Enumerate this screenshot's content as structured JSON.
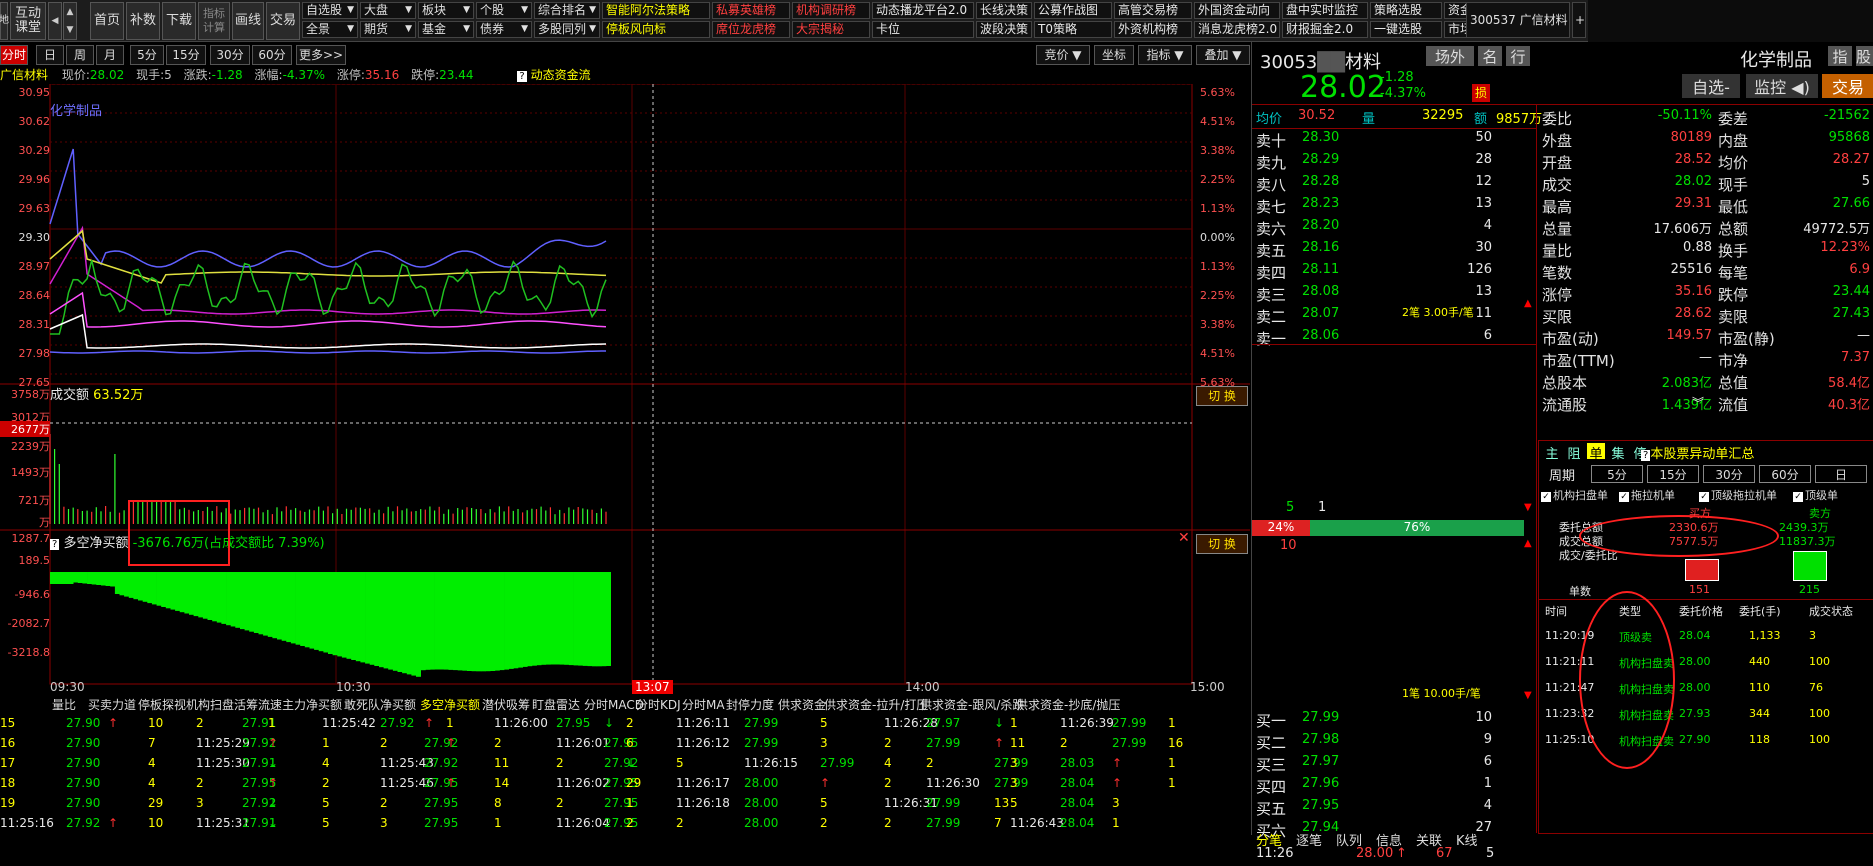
{
  "toolbar": {
    "left_btns": [
      "互动\n课堂",
      "首页",
      "补数",
      "下载",
      "指标\n计算",
      "画线",
      "交易"
    ],
    "menu_row1": [
      {
        "t": "自选股",
        "a": true
      },
      {
        "t": "大盘",
        "a": true
      },
      {
        "t": "板块",
        "a": true
      },
      {
        "t": "个股",
        "a": true
      },
      {
        "t": "综合排名",
        "a": true
      },
      {
        "t": "智能阿尔法策略",
        "c": "yl"
      },
      {
        "t": "私募英雄榜",
        "c": "rd"
      },
      {
        "t": "机构调研榜",
        "c": "rd"
      },
      {
        "t": "动态播龙平台2.0",
        "c": "wh"
      },
      {
        "t": "长线决策",
        "c": "wh"
      },
      {
        "t": "公募作战图",
        "c": "wh"
      },
      {
        "t": "高管交易榜",
        "c": "wh"
      },
      {
        "t": "外国资金动向",
        "c": "wh"
      },
      {
        "t": "盘中实时监控",
        "c": "wh"
      },
      {
        "t": "策略选股",
        "c": "wh"
      },
      {
        "t": "资金动向",
        "c": "wh"
      }
    ],
    "menu_row2": [
      {
        "t": "全景",
        "a": true
      },
      {
        "t": "期货",
        "a": true
      },
      {
        "t": "基金",
        "a": true
      },
      {
        "t": "债券",
        "a": true
      },
      {
        "t": "多股同列",
        "a": true
      },
      {
        "t": "停板风向标",
        "c": "yl"
      },
      {
        "t": "席位龙虎榜",
        "c": "rd"
      },
      {
        "t": "大宗揭秘",
        "c": "rd"
      },
      {
        "t": "卡位",
        "c": "wh"
      },
      {
        "t": "波段决策",
        "c": "wh"
      },
      {
        "t": "T0策略",
        "c": "wh"
      },
      {
        "t": "外资机构榜",
        "c": "wh"
      },
      {
        "t": "消息龙虎榜2.0",
        "c": "wh"
      },
      {
        "t": "财报掘金2.0",
        "c": "wh"
      },
      {
        "t": "一键选股",
        "c": "wh"
      },
      {
        "t": "市场全景图",
        "c": "wh"
      }
    ],
    "stock_tab": "300537 广信材料",
    "plus": "+"
  },
  "periods": [
    "分时",
    "日",
    "周",
    "月",
    "5分",
    "15分",
    "30分",
    "60分",
    "更多>>"
  ],
  "period_right": [
    "竞价",
    "坐标",
    "指标",
    "叠加"
  ],
  "header": {
    "name": "广信材料",
    "price_label": "现价:",
    "price": "28.02",
    "vol_label": "现手:",
    "vol": "5",
    "chg_label": "涨跌:",
    "chg": "-1.28",
    "pct_label": "涨幅:",
    "pct": "-4.37%",
    "up_label": "涨停:",
    "up": "35.16",
    "dn_label": "跌停:",
    "dn": "23.44",
    "flow": "动态资金流"
  },
  "chart": {
    "sector": "化学制品",
    "left_ticks": [
      "30.95",
      "30.62",
      "30.29",
      "29.96",
      "29.63",
      "29.30",
      "28.97",
      "28.64",
      "28.31",
      "27.98",
      "27.65"
    ],
    "right_ticks": [
      "5.63%",
      "4.51%",
      "3.38%",
      "2.25%",
      "1.13%",
      "0.00%",
      "1.13%",
      "2.25%",
      "3.38%",
      "4.51%",
      "5.63%"
    ],
    "vol_title": "成交额",
    "vol_value": "63.52万",
    "vol_ticks": [
      "3758万",
      "3012万",
      "2677万",
      "2239万",
      "1493万",
      "721万",
      "万"
    ],
    "ind_title": "多空净买额",
    "ind_value": "-3676.76万(占成交额比 7.39%)",
    "ind_ticks": [
      "1287.7",
      "189.5",
      "-946.6",
      "-2082.7",
      "-3218.8"
    ],
    "switch": "切 换",
    "time_ticks": [
      "09:30",
      "10:30",
      "13:07",
      "14:00",
      "15:00"
    ]
  },
  "tabs": [
    "量比",
    "买卖力道",
    "停板探视",
    "机构扫盘",
    "活筹流速",
    "主力净买额",
    "敢死队净买额",
    "多空净买额",
    "潜伏吸筹",
    "盯盘雷达",
    "分时MACD",
    "分时KDJ",
    "分时MA",
    "封停力度",
    "供求资金",
    "供求资金-拉升/打压",
    "供求资金-跟风/杀跌",
    "供求资金-抄底/抛压"
  ],
  "ticks": [
    [
      "15",
      "27.90",
      "↑",
      "10",
      "2",
      "27.91",
      "1",
      "11:25:42",
      "27.92",
      "↑",
      "1",
      "11:26:00",
      "27.95",
      "↓",
      "2",
      "11:26:11",
      "27.99",
      "5",
      "11:26:28",
      "27.97",
      "↓",
      "1",
      "11:26:39",
      "27.99",
      "1"
    ],
    [
      "16",
      "27.90",
      "",
      "7",
      "11:25:29",
      "27.92",
      "↑",
      "1",
      "2",
      "27.92",
      "↑",
      "2",
      "11:26:01",
      "27.95",
      "6",
      "11:26:12",
      "27.99",
      "3",
      "2",
      "27.99",
      "↑",
      "11",
      "2",
      "27.99",
      "16"
    ],
    [
      "17",
      "27.90",
      "",
      "4",
      "11:25:30",
      "27.91",
      "↓",
      "4",
      "11:25:43",
      "27.92",
      "",
      "11",
      "2",
      "27.92",
      "↓",
      "5",
      "11:26:15",
      "27.99",
      "4",
      "2",
      "27.99",
      "3",
      "28.03",
      "↑",
      "1"
    ],
    [
      "18",
      "27.90",
      "",
      "4",
      "2",
      "27.95",
      "↑",
      "2",
      "11:25:46",
      "27.95",
      "↑",
      "14",
      "11:26:02",
      "27.95",
      "29",
      "11:26:17",
      "28.00",
      "↑",
      "2",
      "11:26:30",
      "27.99",
      "3",
      "28.04",
      "↑",
      "1"
    ],
    [
      "19",
      "27.90",
      "",
      "29",
      "3",
      "27.92",
      "↓",
      "5",
      "2",
      "27.95",
      "",
      "8",
      "2",
      "27.95",
      "1",
      "11:26:18",
      "28.00",
      "5",
      "11:26:31",
      "27.99",
      "13",
      "5",
      "28.04",
      "3"
    ],
    [
      "11:25:16",
      "27.92",
      "↑",
      "10",
      "11:25:31",
      "27.91",
      "↓",
      "5",
      "3",
      "27.95",
      "",
      "1",
      "11:26:04",
      "27.95",
      "2",
      "2",
      "28.00",
      "2",
      "2",
      "27.99",
      "7",
      "11:26:43",
      "28.04",
      "1"
    ]
  ],
  "rp": {
    "code": "30053",
    "name_tail": "材料",
    "mkt": "场外",
    "btn_ming": "名",
    "btn_hang": "行",
    "sector": "化学制品",
    "zhi": "指",
    "gu": "股",
    "price": "28.02",
    "chg": "-1.28",
    "pct": "-4.37%",
    "badge": "损",
    "xuan": "自选",
    "jk": "监控",
    "jy": "交易",
    "avg_l": "均价",
    "avg": "30.52",
    "vol_l": "量",
    "vol": "32295",
    "amt_l": "额",
    "amt": "9857万",
    "sells": [
      [
        "卖十",
        "28.30",
        "50"
      ],
      [
        "卖九",
        "28.29",
        "28"
      ],
      [
        "卖八",
        "28.28",
        "12"
      ],
      [
        "卖七",
        "28.23",
        "13"
      ],
      [
        "卖六",
        "28.20",
        "4"
      ],
      [
        "卖五",
        "28.16",
        "30"
      ],
      [
        "卖四",
        "28.11",
        "126"
      ],
      [
        "卖三",
        "28.08",
        "13"
      ],
      [
        "卖二",
        "28.07",
        "11"
      ],
      [
        "卖一",
        "28.06",
        "6"
      ]
    ],
    "buys": [
      [
        "买一",
        "27.99",
        "10"
      ],
      [
        "买二",
        "27.98",
        "9"
      ],
      [
        "买三",
        "27.97",
        "6"
      ],
      [
        "买四",
        "27.96",
        "1"
      ],
      [
        "买五",
        "27.95",
        "4"
      ],
      [
        "买六",
        "27.94",
        "27"
      ]
    ],
    "stats": [
      [
        "委比",
        "-50.11%",
        "委差",
        "-21562"
      ],
      [
        "外盘",
        "80189",
        "内盘",
        "95868"
      ],
      [
        "开盘",
        "28.52",
        "均价",
        "28.27"
      ],
      [
        "成交",
        "28.02",
        "现手",
        "5"
      ],
      [
        "最高",
        "29.31",
        "最低",
        "27.66"
      ],
      [
        "总量",
        "17.606万",
        "总额",
        "49772.5万"
      ],
      [
        "量比",
        "0.88",
        "换手",
        "12.23%"
      ],
      [
        "笔数",
        "25516",
        "每笔",
        "6.9"
      ],
      [
        "涨停",
        "35.16",
        "跌停",
        "23.44"
      ],
      [
        "买限",
        "28.62",
        "卖限",
        "27.43"
      ],
      [
        "市盈(动)",
        "149.57",
        "市盈(静)",
        "—"
      ],
      [
        "市盈(TTM)",
        "—",
        "市净",
        "7.37"
      ],
      [
        "总股本",
        "2.083亿",
        "总值",
        "58.4亿"
      ],
      [
        "流通股",
        "1.439亿",
        "流值",
        "40.3亿"
      ]
    ],
    "bar_label1": "2笔 3.00手/笔",
    "bar_n1": "5",
    "bar_n2": "1",
    "bar_n3": "10",
    "bar_pct_l": "24%",
    "bar_pct_r": "76%",
    "bar_label2": "1笔 10.00手/笔",
    "mode_tabs": [
      "主",
      "阻",
      "单",
      "集",
      "停"
    ],
    "mode_title": "本股票异动单汇总",
    "cycle": "周期",
    "cycles": [
      "5分",
      "15分",
      "30分",
      "60分",
      "日"
    ],
    "checks": [
      "机构扫盘单",
      "拖拉机单",
      "顶级拖拉机单",
      "顶级单"
    ],
    "sum_h": [
      "买方",
      "卖方"
    ],
    "sum_rows": [
      [
        "委托总额",
        "2330.6万",
        "2439.3万"
      ],
      [
        "成交总额",
        "7577.5万",
        "11837.3万"
      ],
      [
        "成交/委托比",
        "",
        ""
      ]
    ],
    "dan": "单数",
    "dan_b": "151",
    "dan_s": "215",
    "list_h": [
      "时间",
      "类型",
      "委托价格",
      "委托(手)",
      "成交状态"
    ],
    "list": [
      [
        "11:20:19",
        "顶级卖",
        "28.04",
        "1,133",
        "3"
      ],
      [
        "11:21:11",
        "机构扫盘卖",
        "28.00",
        "440",
        "100"
      ],
      [
        "11:21:47",
        "机构扫盘卖",
        "28.00",
        "110",
        "76"
      ],
      [
        "11:23:32",
        "机构扫盘卖",
        "27.93",
        "344",
        "100"
      ],
      [
        "11:25:10",
        "机构扫盘卖",
        "27.90",
        "118",
        "100"
      ]
    ],
    "bot_tabs": [
      "分笔",
      "逐笔",
      "队列",
      "信息",
      "关联",
      "K线"
    ],
    "bot_row": [
      "11:26",
      "28.00",
      "↑",
      "67",
      "5"
    ]
  }
}
